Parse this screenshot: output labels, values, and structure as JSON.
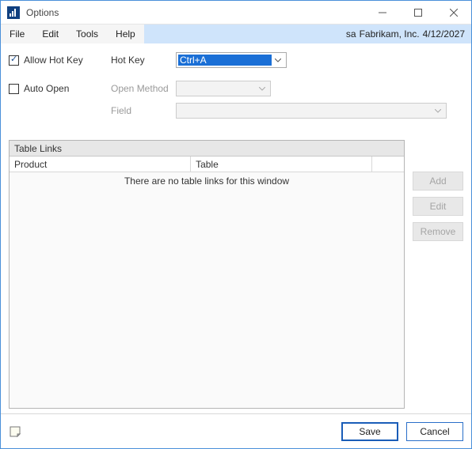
{
  "titlebar": {
    "title": "Options"
  },
  "menubar": {
    "items": [
      "File",
      "Edit",
      "Tools",
      "Help"
    ],
    "user": "sa",
    "company": "Fabrikam, Inc.",
    "date": "4/12/2027"
  },
  "options": {
    "allow_hot_key": {
      "label": "Allow Hot Key",
      "checked": true
    },
    "hot_key": {
      "label": "Hot Key",
      "value": "Ctrl+A"
    },
    "auto_open": {
      "label": "Auto Open",
      "checked": false
    },
    "open_method": {
      "label": "Open Method",
      "value": ""
    },
    "field": {
      "label": "Field",
      "value": ""
    }
  },
  "links": {
    "title": "Table Links",
    "columns": {
      "product": "Product",
      "table": "Table"
    },
    "empty_message": "There are no table links for this window"
  },
  "side_buttons": {
    "add": "Add",
    "edit": "Edit",
    "remove": "Remove"
  },
  "footer": {
    "save": "Save",
    "cancel": "Cancel"
  }
}
